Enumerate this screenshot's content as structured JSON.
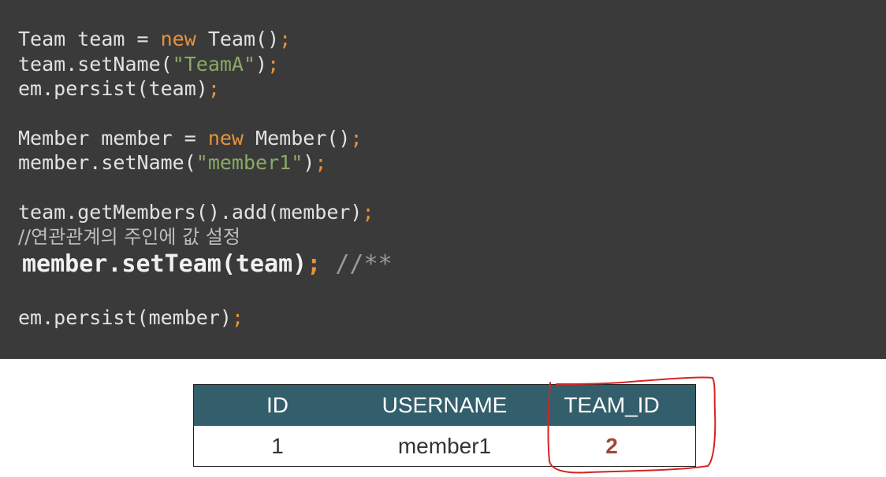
{
  "code": {
    "l1_a": "Team team = ",
    "l1_kw": "new",
    "l1_b": " Team()",
    "l1_semi": ";",
    "l2_a": "team.setName(",
    "l2_str": "\"TeamA\"",
    "l2_b": ")",
    "l2_semi": ";",
    "l3_a": "em.persist(team)",
    "l3_semi": ";",
    "l4_a": "Member member = ",
    "l4_kw": "new",
    "l4_b": " Member()",
    "l4_semi": ";",
    "l5_a": "member.setName(",
    "l5_str": "\"member1\"",
    "l5_b": ")",
    "l5_semi": ";",
    "l6_a": "team.getMembers().add(member)",
    "l6_semi": ";",
    "l7_comment": "//연관관계의 주인에 값 설정",
    "l8_a": "member.setTeam(team)",
    "l8_semi": ";",
    "l8_comment": " //**",
    "l9_a": "em.persist(member)",
    "l9_semi": ";"
  },
  "table": {
    "headers": [
      "ID",
      "USERNAME",
      "TEAM_ID"
    ],
    "row": [
      "1",
      "member1",
      "2"
    ]
  },
  "colors": {
    "code_bg": "#3a3a3a",
    "keyword": "#e8923a",
    "string": "#8aaa66",
    "table_header": "#335e6b",
    "highlight_value": "#a0463a",
    "annotation": "#d62424"
  }
}
